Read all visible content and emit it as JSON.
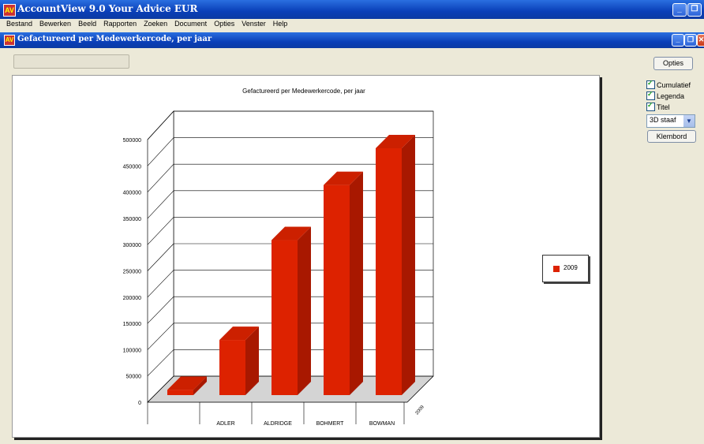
{
  "app": {
    "title": "AccountView 9.0   Your Advice   EUR",
    "icon": "accountview-logo-icon",
    "icon_text": "AV"
  },
  "menu": [
    "Bestand",
    "Bewerken",
    "Beeld",
    "Rapporten",
    "Zoeken",
    "Document",
    "Opties",
    "Venster",
    "Help"
  ],
  "child_window": {
    "title": "Gefactureerd per Medewerkercode, per jaar"
  },
  "panel": {
    "options_button": "Opties",
    "checkboxes": [
      {
        "label": "Cumulatief",
        "checked": true
      },
      {
        "label": "Legenda",
        "checked": true
      },
      {
        "label": "Titel",
        "checked": true
      }
    ],
    "chart_type_select": "3D staaf",
    "clipboard_button": "Klembord"
  },
  "chart_data": {
    "type": "bar",
    "title": "Gefactureerd per Medewerkercode, per jaar",
    "categories": [
      "",
      "ADLER",
      "ALDRIDGE",
      "BOHMERT",
      "BOWMAN"
    ],
    "series": [
      {
        "name": "2009",
        "values": [
          10000,
          105000,
          295000,
          400000,
          470000
        ],
        "color": "#dd2200"
      }
    ],
    "y_ticks": [
      "0",
      "50000",
      "100000",
      "150000",
      "200000",
      "250000",
      "300000",
      "350000",
      "400000",
      "450000",
      "500000"
    ],
    "ylim": [
      0,
      500000
    ],
    "series_axis_label": "2009",
    "grid": true,
    "legend": "right",
    "style": "3d"
  }
}
